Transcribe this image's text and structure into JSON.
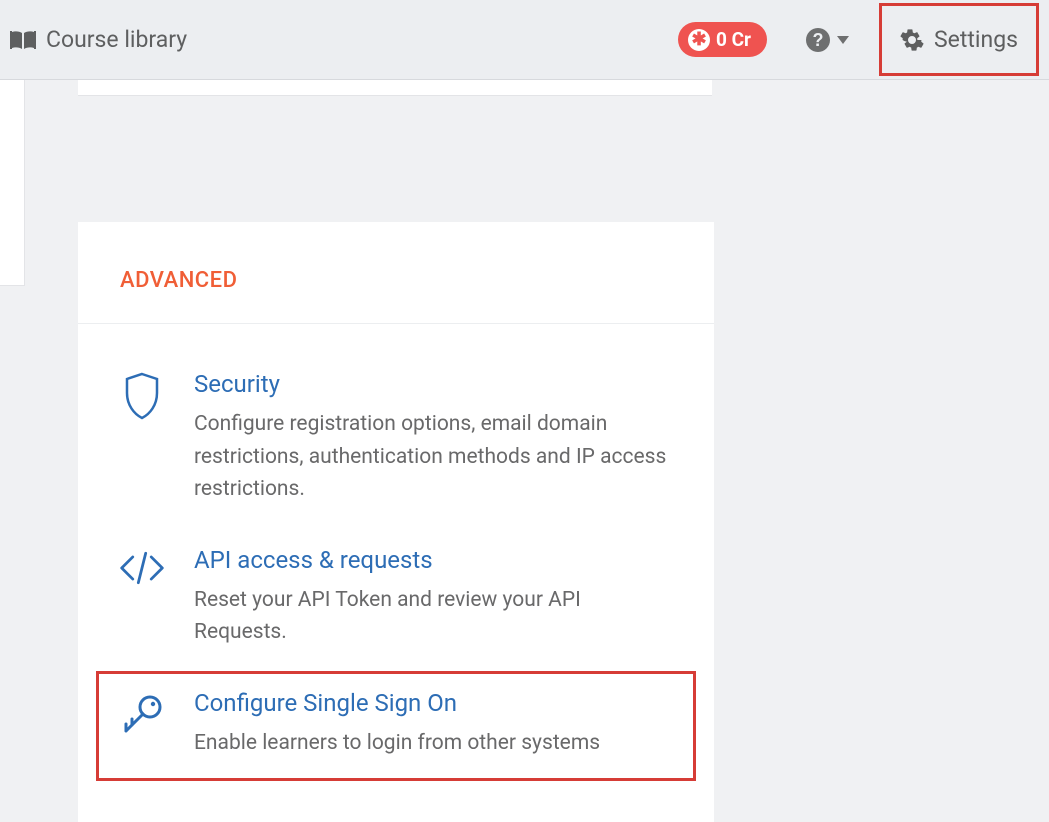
{
  "topbar": {
    "course_library_label": "Course library",
    "credits_label": "0 Cr",
    "settings_label": "Settings"
  },
  "panel": {
    "heading": "ADVANCED",
    "items": [
      {
        "title": "Security",
        "desc": "Configure registration options, email domain restrictions, authentication methods and IP access restrictions."
      },
      {
        "title": "API access & requests",
        "desc": "Reset your API Token and review your API Requests."
      },
      {
        "title": "Configure Single Sign On",
        "desc": "Enable learners to login from other systems"
      }
    ]
  }
}
